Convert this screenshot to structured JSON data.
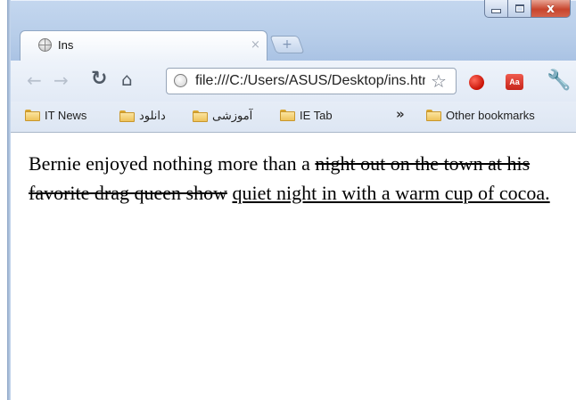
{
  "window": {
    "caption_close": "x"
  },
  "tabs": [
    {
      "title": "Ins",
      "close": "×"
    }
  ],
  "new_tab_glyph": "+",
  "toolbar": {
    "address": "file:///C:/Users/ASUS/Desktop/ins.html"
  },
  "bookmarks": {
    "items": [
      {
        "label": "IT News"
      },
      {
        "label": "دانلود"
      },
      {
        "label": "آموزشی"
      },
      {
        "label": "IE Tab"
      }
    ],
    "overflow": "»",
    "other": "Other bookmarks"
  },
  "content": {
    "text_before": "Bernie enjoyed nothing more than a ",
    "deleted": "night out on the town at his favorite drag queen show",
    "text_between": " ",
    "inserted": "quiet night in with a warm cup of cocoa."
  },
  "icons": {
    "back": "back-arrow-icon",
    "forward": "forward-arrow-icon",
    "reload": "reload-icon",
    "home": "home-icon",
    "star": "bookmark-star-icon",
    "ext1": "red-extension-icon",
    "ext2": "dictionary-extension-icon",
    "menu": "wrench-icon"
  },
  "colors": {
    "frame": "#b7cde9",
    "toolbar": "#e2eaf6",
    "close_button": "#c8452d"
  }
}
